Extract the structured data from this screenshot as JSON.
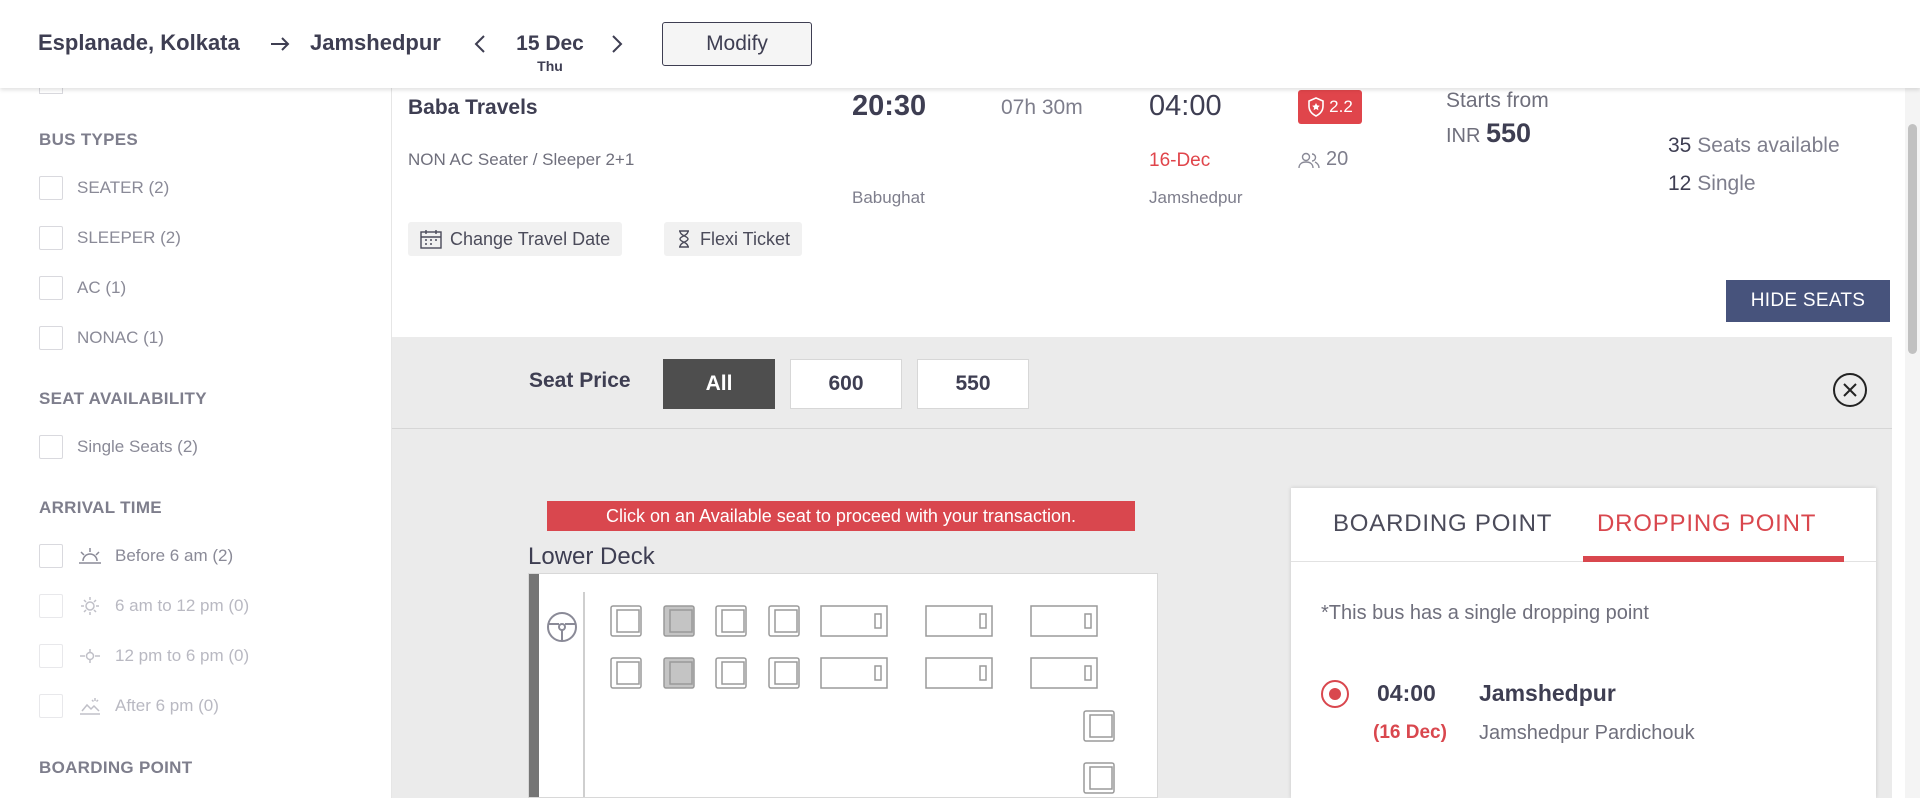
{
  "header": {
    "from": "Esplanade, Kolkata",
    "to": "Jamshedpur",
    "date": "15 Dec",
    "day": "Thu",
    "modify_label": "Modify"
  },
  "filters": {
    "bus_types": {
      "title": "BUS TYPES",
      "items": [
        "SEATER (2)",
        "SLEEPER (2)",
        "AC (1)",
        "NONAC (1)"
      ]
    },
    "seat_availability": {
      "title": "SEAT AVAILABILITY",
      "items": [
        "Single Seats (2)"
      ]
    },
    "arrival_time": {
      "title": "ARRIVAL TIME",
      "items": [
        "Before 6 am (2)",
        "6 am to 12 pm (0)",
        "12 pm to 6 pm (0)",
        "After 6 pm (0)"
      ]
    },
    "boarding_point": {
      "title": "BOARDING POINT"
    }
  },
  "bus": {
    "operator": "Baba Travels",
    "type": "NON AC Seater / Sleeper 2+1",
    "departure_time": "20:30",
    "duration": "07h 30m",
    "arrival_time": "04:00",
    "arrival_date": "16-Dec",
    "departure_place": "Babughat",
    "arrival_place": "Jamshedpur",
    "rating": "2.2",
    "rating_count": "20",
    "starts_from_label": "Starts from",
    "currency": "INR",
    "price": "550",
    "seats_available_count": "35",
    "seats_available_label": "Seats available",
    "single_count": "12",
    "single_label": "Single",
    "change_date_label": "Change Travel Date",
    "flexi_label": "Flexi Ticket",
    "hide_seats_label": "HIDE SEATS"
  },
  "seat_layout": {
    "price_label": "Seat Price",
    "price_options": [
      "All",
      "600",
      "550"
    ],
    "selected_price": "All",
    "notice": "Click on an Available seat to proceed with your transaction.",
    "deck_title": "Lower Deck"
  },
  "points": {
    "tabs": [
      "BOARDING POINT",
      "DROPPING POINT"
    ],
    "active_tab": "DROPPING POINT",
    "note": "*This bus has a single dropping point",
    "time": "04:00",
    "date": "(16 Dec)",
    "name": "Jamshedpur",
    "address": "Jamshedpur Pardichouk"
  },
  "colors": {
    "accent_red": "#d9474e",
    "button_navy": "#47537c",
    "text_dark": "#3e3e52"
  }
}
